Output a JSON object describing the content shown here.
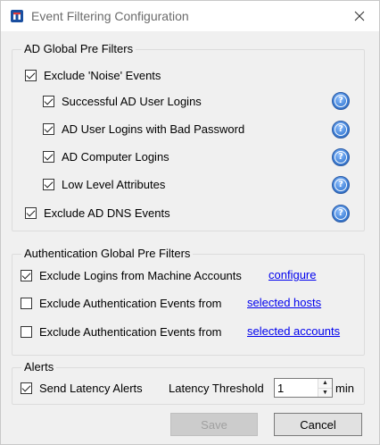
{
  "window": {
    "title": "Event Filtering Configuration",
    "icon": "app-logo-icon",
    "close_icon": "close-icon"
  },
  "ad_group": {
    "legend": "AD Global Pre Filters",
    "noise": {
      "label": "Exclude 'Noise' Events",
      "checked": true
    },
    "items": [
      {
        "label": "Successful AD User Logins",
        "checked": true,
        "help": true
      },
      {
        "label": "AD User Logins with Bad Password",
        "checked": true,
        "help": true
      },
      {
        "label": "AD Computer Logins",
        "checked": true,
        "help": true
      },
      {
        "label": "Low Level Attributes",
        "checked": true,
        "help": true
      }
    ],
    "dns": {
      "label": "Exclude AD DNS Events",
      "checked": true,
      "help": true
    }
  },
  "auth_group": {
    "legend": "Authentication Global Pre Filters",
    "machine": {
      "label": "Exclude Logins from Machine Accounts",
      "checked": true,
      "link": "configure"
    },
    "hosts": {
      "label": "Exclude Authentication Events from",
      "checked": false,
      "link": "selected hosts"
    },
    "accounts": {
      "label": "Exclude Authentication Events from",
      "checked": false,
      "link": "selected accounts"
    }
  },
  "alerts_group": {
    "legend": "Alerts",
    "latency": {
      "label": "Send Latency Alerts",
      "checked": true
    },
    "threshold_label": "Latency Threshold",
    "threshold_value": "1",
    "unit": "min"
  },
  "buttons": {
    "save": "Save",
    "cancel": "Cancel"
  }
}
